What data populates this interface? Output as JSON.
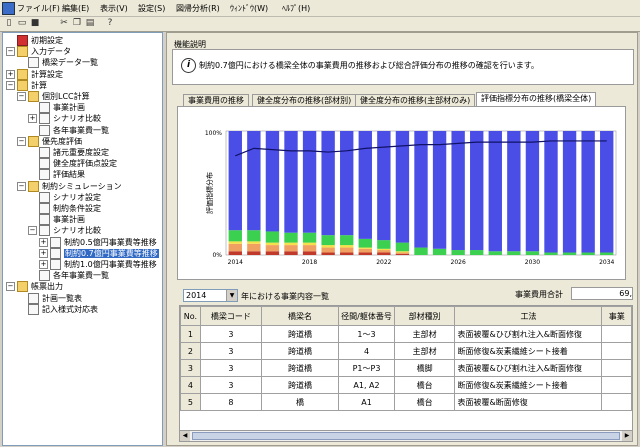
{
  "menu": [
    "ファイル(F)",
    "編集(E)",
    "表示(V)",
    "設定(S)",
    "図帰分析(R)",
    "ｳｨﾝﾄﾞｳ(W)",
    "ﾍﾙﾌﾟ(H)"
  ],
  "toolbar": {
    "icons": [
      "new-icon",
      "open-icon",
      "save-icon",
      "cut-icon",
      "copy-icon",
      "paste-icon",
      "help-icon"
    ],
    "glyphs": [
      "▯",
      "▭",
      "■",
      "✂",
      "❐",
      "▤",
      "?"
    ]
  },
  "tree": [
    {
      "label": "初期設定",
      "level": 0,
      "icon": "red",
      "exp": ""
    },
    {
      "label": "入力データ",
      "level": 0,
      "icon": "folder",
      "exp": "−"
    },
    {
      "label": "橋梁データ一覧",
      "level": 1,
      "icon": "doc",
      "exp": ""
    },
    {
      "label": "計算設定",
      "level": 0,
      "icon": "folder",
      "exp": "+"
    },
    {
      "label": "計算",
      "level": 0,
      "icon": "folder",
      "exp": "−"
    },
    {
      "label": "個別LCC計算",
      "level": 1,
      "icon": "folder",
      "exp": "−"
    },
    {
      "label": "事業計画",
      "level": 2,
      "icon": "doc",
      "exp": ""
    },
    {
      "label": "シナリオ比較",
      "level": 2,
      "icon": "doc",
      "exp": "+"
    },
    {
      "label": "各年事業費一覧",
      "level": 2,
      "icon": "doc",
      "exp": ""
    },
    {
      "label": "優先度評価",
      "level": 1,
      "icon": "folder",
      "exp": "−"
    },
    {
      "label": "諸元重要度設定",
      "level": 2,
      "icon": "doc",
      "exp": ""
    },
    {
      "label": "健全度評価点設定",
      "level": 2,
      "icon": "doc",
      "exp": ""
    },
    {
      "label": "評価結果",
      "level": 2,
      "icon": "doc",
      "exp": ""
    },
    {
      "label": "制約シミュレーション",
      "level": 1,
      "icon": "folder",
      "exp": "−"
    },
    {
      "label": "シナリオ設定",
      "level": 2,
      "icon": "doc",
      "exp": ""
    },
    {
      "label": "制約条件設定",
      "level": 2,
      "icon": "doc",
      "exp": ""
    },
    {
      "label": "事業計画",
      "level": 2,
      "icon": "doc",
      "exp": ""
    },
    {
      "label": "シナリオ比較",
      "level": 2,
      "icon": "doc",
      "exp": "−"
    },
    {
      "label": "制約0.5億円事業費等推移",
      "level": 3,
      "icon": "doc",
      "exp": "+"
    },
    {
      "label": "制約0.7億円事業費等推移",
      "level": 3,
      "icon": "doc",
      "exp": "+",
      "selected": true
    },
    {
      "label": "制約1.0億円事業費等推移",
      "level": 3,
      "icon": "doc",
      "exp": "+"
    },
    {
      "label": "各年事業費一覧",
      "level": 2,
      "icon": "doc",
      "exp": ""
    },
    {
      "label": "帳票出力",
      "level": 0,
      "icon": "folder",
      "exp": "−"
    },
    {
      "label": "計画一覧表",
      "level": 1,
      "icon": "doc",
      "exp": ""
    },
    {
      "label": "記入様式対応表",
      "level": 1,
      "icon": "doc",
      "exp": ""
    }
  ],
  "group_label": "機能説明",
  "info_text": "制約0.7億円における橋梁全体の事業費用の推移および総合評価分布の推移の確認を行います。",
  "tabs": [
    "事業費用の推移",
    "健全度分布の推移(部材別)",
    "健全度分布の推移(主部材のみ)",
    "評価指標分布の推移(橋梁全体)"
  ],
  "active_tab": 3,
  "year_select": "2014",
  "year_label": "年における事業内容一覧",
  "total_label": "事業費用合計",
  "total_value": "69,",
  "table": {
    "headers": [
      "No.",
      "橋梁コード",
      "橋梁名",
      "径間/躯体番号",
      "部材種別",
      "工法",
      "事業"
    ],
    "rows": [
      [
        "1",
        "3",
        "跨道橋",
        "1～3",
        "主部材",
        "表面被覆&ひび割れ注入&断面修復",
        ""
      ],
      [
        "2",
        "3",
        "跨道橋",
        "4",
        "主部材",
        "断面修復&炭素繊維シート接着",
        ""
      ],
      [
        "3",
        "3",
        "跨道橋",
        "P1～P3",
        "橋脚",
        "表面被覆&ひび割れ注入&断面修復",
        ""
      ],
      [
        "4",
        "3",
        "跨道橋",
        "A1, A2",
        "橋台",
        "断面修復&炭素繊維シート接着",
        ""
      ],
      [
        "5",
        "8",
        "橋",
        "A1",
        "橋台",
        "表面被覆&断面修復",
        ""
      ]
    ]
  },
  "chart_data": {
    "type": "bar",
    "stacked": true,
    "ylabel": "評価指標分布",
    "ytick_labels": [
      "100%",
      "0%"
    ],
    "ylim": [
      0,
      100
    ],
    "x_tick_labels": [
      "2014",
      "2018",
      "2022",
      "2026",
      "2030",
      "2034"
    ],
    "categories": [
      "2014",
      "2015",
      "2016",
      "2017",
      "2018",
      "2019",
      "2020",
      "2021",
      "2022",
      "2023",
      "2024",
      "2025",
      "2026",
      "2027",
      "2028",
      "2029",
      "2030",
      "2031",
      "2032",
      "2033",
      "2034"
    ],
    "series": [
      {
        "color": "#c0392b",
        "values": [
          3,
          3,
          3,
          3,
          3,
          2,
          2,
          2,
          2,
          1,
          0,
          0,
          0,
          0,
          0,
          0,
          0,
          0,
          0,
          0,
          0
        ]
      },
      {
        "color": "#f0a060",
        "values": [
          6,
          6,
          5,
          5,
          5,
          4,
          4,
          3,
          2,
          1,
          0,
          0,
          0,
          0,
          0,
          0,
          0,
          0,
          0,
          0,
          0
        ]
      },
      {
        "color": "#f4e04a",
        "values": [
          2,
          2,
          2,
          2,
          2,
          2,
          2,
          1,
          1,
          1,
          0,
          0,
          0,
          0,
          0,
          0,
          0,
          0,
          0,
          0,
          0
        ]
      },
      {
        "color": "#3cd050",
        "values": [
          9,
          9,
          9,
          8,
          8,
          8,
          8,
          7,
          7,
          7,
          6,
          5,
          4,
          4,
          3,
          3,
          3,
          2,
          2,
          2,
          2
        ]
      },
      {
        "color": "#4a4ee6",
        "values": [
          80,
          80,
          81,
          82,
          82,
          84,
          84,
          87,
          88,
          90,
          94,
          95,
          96,
          96,
          97,
          97,
          97,
          98,
          98,
          98,
          98
        ]
      }
    ],
    "line": {
      "color": "#111166",
      "values": [
        80,
        86,
        85,
        84,
        84,
        83,
        84,
        86,
        87,
        88,
        89,
        89,
        90,
        91,
        91,
        91,
        91,
        92,
        92,
        92,
        92
      ]
    }
  }
}
